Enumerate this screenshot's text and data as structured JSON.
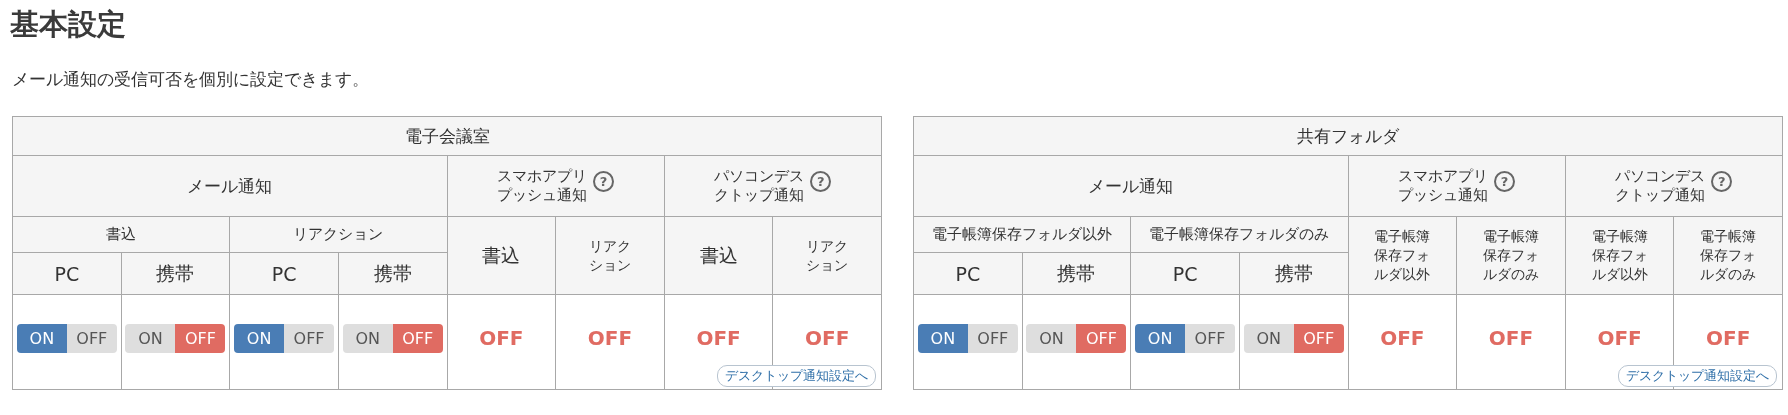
{
  "page": {
    "title": "基本設定",
    "description": "メール通知の受信可否を個別に設定できます。"
  },
  "panels": [
    {
      "title": "電子会議室",
      "mail_label": "メール通知",
      "push_label": "スマホアプリプッシュ通知",
      "desktop_label": "パソコンデスクトップ通知",
      "help_icon": "?",
      "groups": [
        "書込",
        "リアクション"
      ],
      "devices": [
        "PC",
        "携帯",
        "PC",
        "携帯"
      ],
      "push_columns": [
        "書込",
        "リアクション"
      ],
      "desktop_columns": [
        "書込",
        "リアクション"
      ],
      "toggles": [
        {
          "on_label": "ON",
          "off_label": "OFF",
          "on": true
        },
        {
          "on_label": "ON",
          "off_label": "OFF",
          "on": false
        },
        {
          "on_label": "ON",
          "off_label": "OFF",
          "on": true
        },
        {
          "on_label": "ON",
          "off_label": "OFF",
          "on": false
        }
      ],
      "push_values": [
        "OFF",
        "OFF"
      ],
      "desktop_values": [
        "OFF",
        "OFF"
      ],
      "desktop_link": "デスクトップ通知設定へ"
    },
    {
      "title": "共有フォルダ",
      "mail_label": "メール通知",
      "push_label": "スマホアプリプッシュ通知",
      "desktop_label": "パソコンデスクトップ通知",
      "help_icon": "?",
      "groups": [
        "電子帳簿保存フォルダ以外",
        "電子帳簿保存フォルダのみ"
      ],
      "devices": [
        "PC",
        "携帯",
        "PC",
        "携帯"
      ],
      "push_columns": [
        "電子帳簿保存フォルダ以外",
        "電子帳簿保存フォルダのみ"
      ],
      "desktop_columns": [
        "電子帳簿保存フォルダ以外",
        "電子帳簿保存フォルダのみ"
      ],
      "toggles": [
        {
          "on_label": "ON",
          "off_label": "OFF",
          "on": true
        },
        {
          "on_label": "ON",
          "off_label": "OFF",
          "on": false
        },
        {
          "on_label": "ON",
          "off_label": "OFF",
          "on": true
        },
        {
          "on_label": "ON",
          "off_label": "OFF",
          "on": false
        }
      ],
      "push_values": [
        "OFF",
        "OFF"
      ],
      "desktop_values": [
        "OFF",
        "OFF"
      ],
      "desktop_link": "デスクトップ通知設定へ"
    }
  ]
}
